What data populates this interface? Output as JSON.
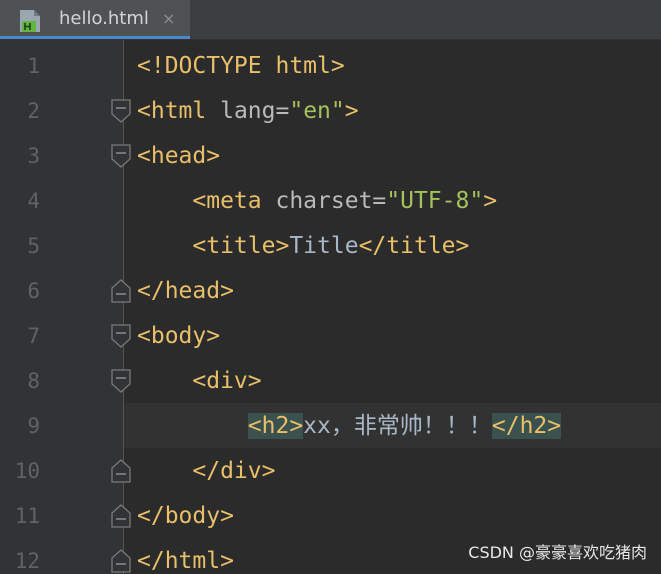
{
  "tab": {
    "label": "hello.html",
    "close": "×",
    "icon": "html-file-icon"
  },
  "colors": {
    "background": "#2b2b2b",
    "gutter": "#313335",
    "tag": "#e8bf6a",
    "string": "#a5c25c",
    "attribute": "#bababa",
    "text": "#a9b7c6",
    "tab_underline": "#4a88c7",
    "tag_highlight": "#3b514d"
  },
  "editor": {
    "current_line": 9,
    "lines": [
      {
        "number": "1",
        "open": "<!DOCTYPE html>"
      },
      {
        "number": "2",
        "open": "<html",
        "attr": " lang=",
        "value": "\"en\"",
        "close": ">"
      },
      {
        "number": "3",
        "open": "<head>"
      },
      {
        "number": "4",
        "indent": "    ",
        "open": "<meta",
        "attr": " charset=",
        "value": "\"UTF-8\"",
        "close": ">"
      },
      {
        "number": "5",
        "indent": "    ",
        "open": "<title>",
        "text": "Title",
        "close": "</title>"
      },
      {
        "number": "6",
        "open": "</head>"
      },
      {
        "number": "7",
        "open": "<body>"
      },
      {
        "number": "8",
        "indent": "    ",
        "open": "<div>"
      },
      {
        "number": "9",
        "indent": "        ",
        "open": "<h2>",
        "text": "xx，非常帅！！！",
        "close": "</h2>"
      },
      {
        "number": "10",
        "indent": "    ",
        "open": "</div>"
      },
      {
        "number": "11",
        "open": "</body>"
      },
      {
        "number": "12",
        "open": "</html>"
      }
    ]
  },
  "watermark": "CSDN @豪豪喜欢吃猪肉"
}
